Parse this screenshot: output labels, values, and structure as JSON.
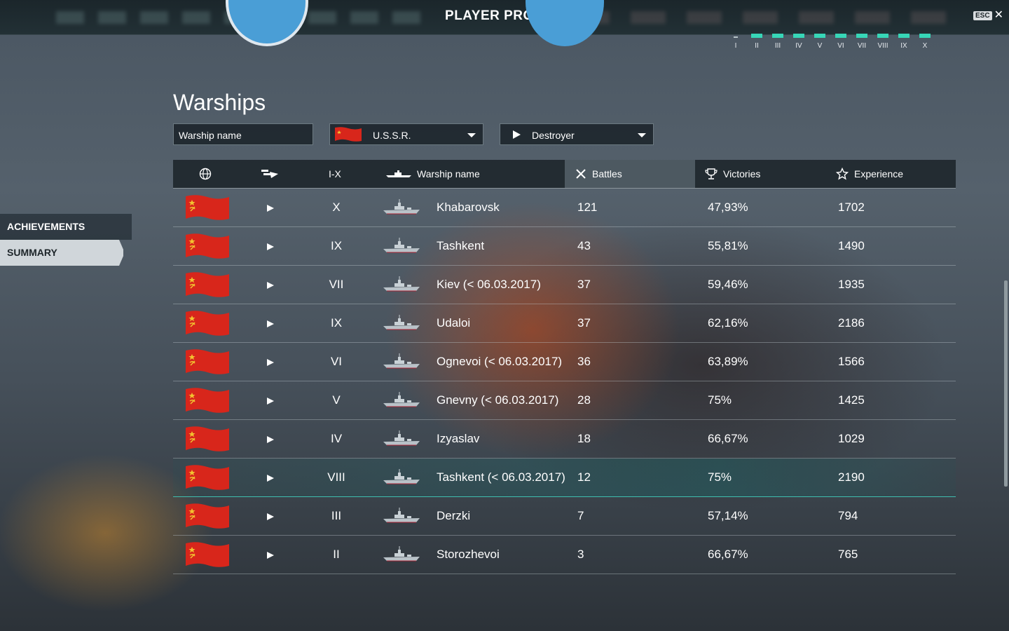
{
  "header": {
    "title": "PLAYER PROFILE",
    "esc_label": "ESC"
  },
  "tier_distribution": {
    "tiers": [
      "I",
      "II",
      "III",
      "IV",
      "V",
      "VI",
      "VII",
      "VIII",
      "IX",
      "X"
    ],
    "bar_color": "#37d6b7"
  },
  "sidebar": {
    "items": [
      {
        "label": "ACHIEVEMENTS"
      },
      {
        "label": "SUMMARY"
      }
    ]
  },
  "warships": {
    "title": "Warships",
    "filters": {
      "name_placeholder": "Warship name",
      "nation_value": "U.S.S.R.",
      "class_value": "Destroyer"
    },
    "columns": {
      "tier": "I-X",
      "name": "Warship name",
      "battles": "Battles",
      "victories": "Victories",
      "experience": "Experience"
    },
    "rows": [
      {
        "tier": "X",
        "name": "Khabarovsk",
        "battles": "121",
        "victories": "47,93%",
        "experience": "1702"
      },
      {
        "tier": "IX",
        "name": "Tashkent",
        "battles": "43",
        "victories": "55,81%",
        "experience": "1490"
      },
      {
        "tier": "VII",
        "name": "Kiev (< 06.03.2017)",
        "battles": "37",
        "victories": "59,46%",
        "experience": "1935"
      },
      {
        "tier": "IX",
        "name": "Udaloi",
        "battles": "37",
        "victories": "62,16%",
        "experience": "2186"
      },
      {
        "tier": "VI",
        "name": "Ognevoi (< 06.03.2017)",
        "battles": "36",
        "victories": "63,89%",
        "experience": "1566"
      },
      {
        "tier": "V",
        "name": "Gnevny (< 06.03.2017)",
        "battles": "28",
        "victories": "75%",
        "experience": "1425"
      },
      {
        "tier": "IV",
        "name": "Izyaslav",
        "battles": "18",
        "victories": "66,67%",
        "experience": "1029"
      },
      {
        "tier": "VIII",
        "name": "Tashkent (< 06.03.2017)",
        "battles": "12",
        "victories": "75%",
        "experience": "2190"
      },
      {
        "tier": "III",
        "name": "Derzki",
        "battles": "7",
        "victories": "57,14%",
        "experience": "794"
      },
      {
        "tier": "II",
        "name": "Storozhevoi",
        "battles": "3",
        "victories": "66,67%",
        "experience": "765"
      }
    ]
  },
  "colors": {
    "accent": "#37d6b7",
    "flag_red": "#d8261b",
    "highlight_row": "#3fbfb0"
  }
}
